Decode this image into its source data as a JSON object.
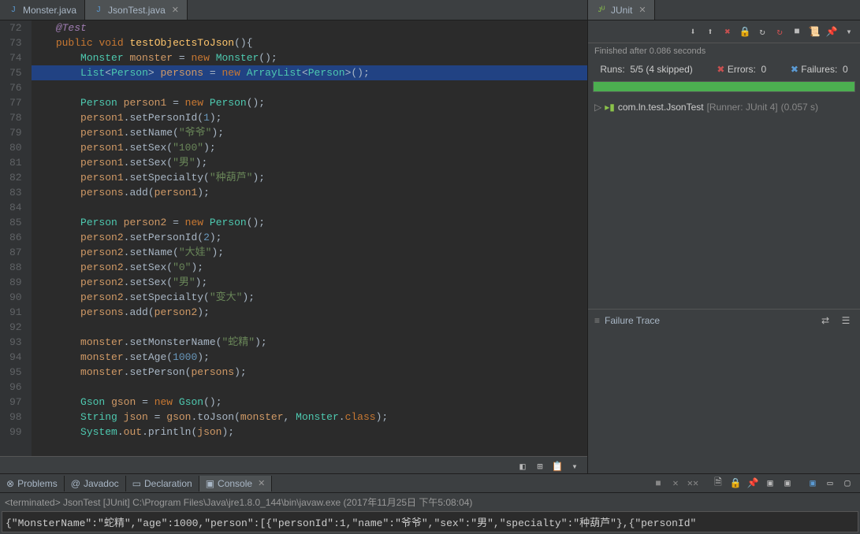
{
  "editor": {
    "tabs": [
      {
        "label": "Monster.java",
        "active": false
      },
      {
        "label": "JsonTest.java",
        "active": true
      }
    ],
    "lines": [
      {
        "num": "72",
        "tokens": [
          {
            "t": "    ",
            "c": ""
          },
          {
            "t": "@Test",
            "c": "annotation"
          }
        ]
      },
      {
        "num": "73",
        "tokens": [
          {
            "t": "    ",
            "c": ""
          },
          {
            "t": "public",
            "c": "keyword"
          },
          {
            "t": " ",
            "c": ""
          },
          {
            "t": "void",
            "c": "keyword"
          },
          {
            "t": " ",
            "c": ""
          },
          {
            "t": "testObjectsToJson",
            "c": "method-decl"
          },
          {
            "t": "(){",
            "c": "white"
          }
        ]
      },
      {
        "num": "74",
        "tokens": [
          {
            "t": "        ",
            "c": ""
          },
          {
            "t": "Monster",
            "c": "green-type"
          },
          {
            "t": " ",
            "c": ""
          },
          {
            "t": "monster",
            "c": "orange-var"
          },
          {
            "t": " = ",
            "c": "white"
          },
          {
            "t": "new",
            "c": "keyword"
          },
          {
            "t": " ",
            "c": ""
          },
          {
            "t": "Monster",
            "c": "green-type"
          },
          {
            "t": "();",
            "c": "white"
          }
        ]
      },
      {
        "num": "75",
        "highlighted": true,
        "tokens": [
          {
            "t": "        ",
            "c": ""
          },
          {
            "t": "List",
            "c": "green-type"
          },
          {
            "t": "<",
            "c": "white"
          },
          {
            "t": "Person",
            "c": "green-type"
          },
          {
            "t": "> ",
            "c": "white"
          },
          {
            "t": "persons",
            "c": "orange-var"
          },
          {
            "t": " = ",
            "c": "white"
          },
          {
            "t": "new",
            "c": "keyword"
          },
          {
            "t": " ",
            "c": ""
          },
          {
            "t": "ArrayList",
            "c": "green-type"
          },
          {
            "t": "<",
            "c": "white"
          },
          {
            "t": "Person",
            "c": "green-type"
          },
          {
            "t": ">();",
            "c": "white"
          }
        ]
      },
      {
        "num": "76",
        "tokens": []
      },
      {
        "num": "77",
        "tokens": [
          {
            "t": "        ",
            "c": ""
          },
          {
            "t": "Person",
            "c": "green-type"
          },
          {
            "t": " ",
            "c": ""
          },
          {
            "t": "person1",
            "c": "orange-var"
          },
          {
            "t": " = ",
            "c": "white"
          },
          {
            "t": "new",
            "c": "keyword"
          },
          {
            "t": " ",
            "c": ""
          },
          {
            "t": "Person",
            "c": "green-type"
          },
          {
            "t": "();",
            "c": "white"
          }
        ]
      },
      {
        "num": "78",
        "tokens": [
          {
            "t": "        ",
            "c": ""
          },
          {
            "t": "person1",
            "c": "orange-var"
          },
          {
            "t": ".setPersonId(",
            "c": "white"
          },
          {
            "t": "1",
            "c": "number"
          },
          {
            "t": ");",
            "c": "white"
          }
        ]
      },
      {
        "num": "79",
        "tokens": [
          {
            "t": "        ",
            "c": ""
          },
          {
            "t": "person1",
            "c": "orange-var"
          },
          {
            "t": ".setName(",
            "c": "white"
          },
          {
            "t": "\"爷爷\"",
            "c": "string"
          },
          {
            "t": ");",
            "c": "white"
          }
        ]
      },
      {
        "num": "80",
        "tokens": [
          {
            "t": "        ",
            "c": ""
          },
          {
            "t": "person1",
            "c": "orange-var"
          },
          {
            "t": ".setSex(",
            "c": "white"
          },
          {
            "t": "\"100\"",
            "c": "string"
          },
          {
            "t": ");",
            "c": "white"
          }
        ]
      },
      {
        "num": "81",
        "tokens": [
          {
            "t": "        ",
            "c": ""
          },
          {
            "t": "person1",
            "c": "orange-var"
          },
          {
            "t": ".setSex(",
            "c": "white"
          },
          {
            "t": "\"男\"",
            "c": "string"
          },
          {
            "t": ");",
            "c": "white"
          }
        ]
      },
      {
        "num": "82",
        "tokens": [
          {
            "t": "        ",
            "c": ""
          },
          {
            "t": "person1",
            "c": "orange-var"
          },
          {
            "t": ".setSpecialty(",
            "c": "white"
          },
          {
            "t": "\"种葫芦\"",
            "c": "string"
          },
          {
            "t": ");",
            "c": "white"
          }
        ]
      },
      {
        "num": "83",
        "tokens": [
          {
            "t": "        ",
            "c": ""
          },
          {
            "t": "persons",
            "c": "orange-var"
          },
          {
            "t": ".add(",
            "c": "white"
          },
          {
            "t": "person1",
            "c": "orange-var"
          },
          {
            "t": ");",
            "c": "white"
          }
        ]
      },
      {
        "num": "84",
        "tokens": []
      },
      {
        "num": "85",
        "tokens": [
          {
            "t": "        ",
            "c": ""
          },
          {
            "t": "Person",
            "c": "green-type"
          },
          {
            "t": " ",
            "c": ""
          },
          {
            "t": "person2",
            "c": "orange-var"
          },
          {
            "t": " = ",
            "c": "white"
          },
          {
            "t": "new",
            "c": "keyword"
          },
          {
            "t": " ",
            "c": ""
          },
          {
            "t": "Person",
            "c": "green-type"
          },
          {
            "t": "();",
            "c": "white"
          }
        ]
      },
      {
        "num": "86",
        "tokens": [
          {
            "t": "        ",
            "c": ""
          },
          {
            "t": "person2",
            "c": "orange-var"
          },
          {
            "t": ".setPersonId(",
            "c": "white"
          },
          {
            "t": "2",
            "c": "number"
          },
          {
            "t": ");",
            "c": "white"
          }
        ]
      },
      {
        "num": "87",
        "tokens": [
          {
            "t": "        ",
            "c": ""
          },
          {
            "t": "person2",
            "c": "orange-var"
          },
          {
            "t": ".setName(",
            "c": "white"
          },
          {
            "t": "\"大娃\"",
            "c": "string"
          },
          {
            "t": ");",
            "c": "white"
          }
        ]
      },
      {
        "num": "88",
        "tokens": [
          {
            "t": "        ",
            "c": ""
          },
          {
            "t": "person2",
            "c": "orange-var"
          },
          {
            "t": ".setSex(",
            "c": "white"
          },
          {
            "t": "\"0\"",
            "c": "string"
          },
          {
            "t": ");",
            "c": "white"
          }
        ]
      },
      {
        "num": "89",
        "tokens": [
          {
            "t": "        ",
            "c": ""
          },
          {
            "t": "person2",
            "c": "orange-var"
          },
          {
            "t": ".setSex(",
            "c": "white"
          },
          {
            "t": "\"男\"",
            "c": "string"
          },
          {
            "t": ");",
            "c": "white"
          }
        ]
      },
      {
        "num": "90",
        "tokens": [
          {
            "t": "        ",
            "c": ""
          },
          {
            "t": "person2",
            "c": "orange-var"
          },
          {
            "t": ".setSpecialty(",
            "c": "white"
          },
          {
            "t": "\"变大\"",
            "c": "string"
          },
          {
            "t": ");",
            "c": "white"
          }
        ]
      },
      {
        "num": "91",
        "tokens": [
          {
            "t": "        ",
            "c": ""
          },
          {
            "t": "persons",
            "c": "orange-var"
          },
          {
            "t": ".add(",
            "c": "white"
          },
          {
            "t": "person2",
            "c": "orange-var"
          },
          {
            "t": ");",
            "c": "white"
          }
        ]
      },
      {
        "num": "92",
        "tokens": []
      },
      {
        "num": "93",
        "tokens": [
          {
            "t": "        ",
            "c": ""
          },
          {
            "t": "monster",
            "c": "orange-var"
          },
          {
            "t": ".setMonsterName(",
            "c": "white"
          },
          {
            "t": "\"蛇精\"",
            "c": "string"
          },
          {
            "t": ");",
            "c": "white"
          }
        ]
      },
      {
        "num": "94",
        "tokens": [
          {
            "t": "        ",
            "c": ""
          },
          {
            "t": "monster",
            "c": "orange-var"
          },
          {
            "t": ".setAge(",
            "c": "white"
          },
          {
            "t": "1000",
            "c": "number"
          },
          {
            "t": ");",
            "c": "white"
          }
        ]
      },
      {
        "num": "95",
        "tokens": [
          {
            "t": "        ",
            "c": ""
          },
          {
            "t": "monster",
            "c": "orange-var"
          },
          {
            "t": ".setPerson(",
            "c": "white"
          },
          {
            "t": "persons",
            "c": "orange-var"
          },
          {
            "t": ");",
            "c": "white"
          }
        ]
      },
      {
        "num": "96",
        "tokens": []
      },
      {
        "num": "97",
        "tokens": [
          {
            "t": "        ",
            "c": ""
          },
          {
            "t": "Gson",
            "c": "green-type"
          },
          {
            "t": " ",
            "c": ""
          },
          {
            "t": "gson",
            "c": "orange-var"
          },
          {
            "t": " = ",
            "c": "white"
          },
          {
            "t": "new",
            "c": "keyword"
          },
          {
            "t": " ",
            "c": ""
          },
          {
            "t": "Gson",
            "c": "green-type"
          },
          {
            "t": "();",
            "c": "white"
          }
        ]
      },
      {
        "num": "98",
        "tokens": [
          {
            "t": "        ",
            "c": ""
          },
          {
            "t": "String",
            "c": "green-type"
          },
          {
            "t": " ",
            "c": ""
          },
          {
            "t": "json",
            "c": "orange-var"
          },
          {
            "t": " = ",
            "c": "white"
          },
          {
            "t": "gson",
            "c": "orange-var"
          },
          {
            "t": ".toJson(",
            "c": "white"
          },
          {
            "t": "monster",
            "c": "orange-var"
          },
          {
            "t": ", ",
            "c": "white"
          },
          {
            "t": "Monster",
            "c": "green-type"
          },
          {
            "t": ".",
            "c": "white"
          },
          {
            "t": "class",
            "c": "keyword"
          },
          {
            "t": ");",
            "c": "white"
          }
        ]
      },
      {
        "num": "99",
        "tokens": [
          {
            "t": "        ",
            "c": ""
          },
          {
            "t": "System",
            "c": "green-type"
          },
          {
            "t": ".",
            "c": "white"
          },
          {
            "t": "out",
            "c": "orange-var"
          },
          {
            "t": ".println(",
            "c": "white"
          },
          {
            "t": "json",
            "c": "orange-var"
          },
          {
            "t": ");",
            "c": "white"
          }
        ]
      }
    ]
  },
  "junit": {
    "tab_label": "JUnit",
    "status": "Finished after 0.086 seconds",
    "runs_label": "Runs:",
    "runs_value": "5/5 (4 skipped)",
    "errors_label": "Errors:",
    "errors_value": "0",
    "failures_label": "Failures:",
    "failures_value": "0",
    "tree_item": "com.ln.test.JsonTest",
    "tree_runner": "[Runner: JUnit 4]",
    "tree_time": "(0.057 s)",
    "failure_trace_label": "Failure Trace"
  },
  "bottom": {
    "tabs": [
      {
        "label": "Problems",
        "icon": "⊗"
      },
      {
        "label": "Javadoc",
        "icon": "@"
      },
      {
        "label": "Declaration",
        "icon": "▭"
      },
      {
        "label": "Console",
        "icon": "▣",
        "active": true
      }
    ],
    "console_status": "<terminated> JsonTest [JUnit] C:\\Program Files\\Java\\jre1.8.0_144\\bin\\javaw.exe (2017年11月25日 下午5:08:04)",
    "console_output": "{\"MonsterName\":\"蛇精\",\"age\":1000,\"person\":[{\"personId\":1,\"name\":\"爷爷\",\"sex\":\"男\",\"specialty\":\"种葫芦\"},{\"personId\""
  }
}
